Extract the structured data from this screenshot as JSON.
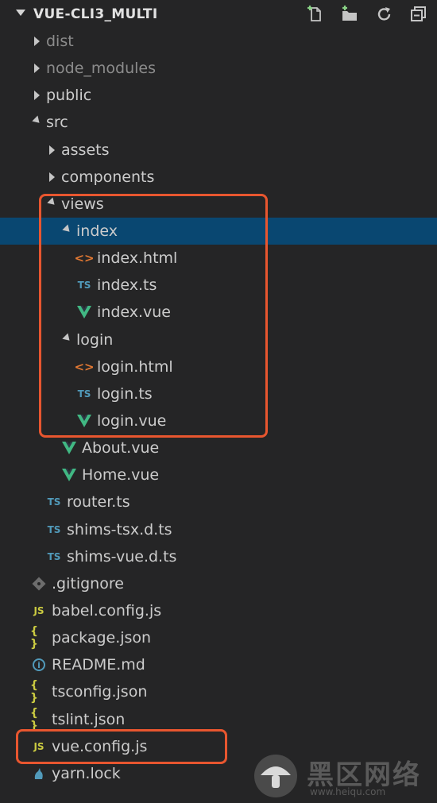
{
  "explorer": {
    "title": "VUE-CLI3_MULTI",
    "actions": [
      {
        "name": "new-file",
        "icon": "new-file-icon"
      },
      {
        "name": "new-folder",
        "icon": "new-folder-icon"
      },
      {
        "name": "refresh",
        "icon": "refresh-icon"
      },
      {
        "name": "collapse-all",
        "icon": "collapse-all-icon"
      }
    ]
  },
  "tree": [
    {
      "label": "dist",
      "type": "folder",
      "expanded": false,
      "depth": 0,
      "dim": true
    },
    {
      "label": "node_modules",
      "type": "folder",
      "expanded": false,
      "depth": 0,
      "dim": true
    },
    {
      "label": "public",
      "type": "folder",
      "expanded": false,
      "depth": 0
    },
    {
      "label": "src",
      "type": "folder",
      "expanded": true,
      "depth": 0
    },
    {
      "label": "assets",
      "type": "folder",
      "expanded": false,
      "depth": 1
    },
    {
      "label": "components",
      "type": "folder",
      "expanded": false,
      "depth": 1
    },
    {
      "label": "views",
      "type": "folder",
      "expanded": true,
      "depth": 1
    },
    {
      "label": "index",
      "type": "folder",
      "expanded": true,
      "depth": 2,
      "selected": true
    },
    {
      "label": "index.html",
      "type": "html",
      "depth": 3
    },
    {
      "label": "index.ts",
      "type": "ts",
      "depth": 3
    },
    {
      "label": "index.vue",
      "type": "vue",
      "depth": 3
    },
    {
      "label": "login",
      "type": "folder",
      "expanded": true,
      "depth": 2
    },
    {
      "label": "login.html",
      "type": "html",
      "depth": 3
    },
    {
      "label": "login.ts",
      "type": "ts",
      "depth": 3
    },
    {
      "label": "login.vue",
      "type": "vue",
      "depth": 3
    },
    {
      "label": "About.vue",
      "type": "vue",
      "depth": 2
    },
    {
      "label": "Home.vue",
      "type": "vue",
      "depth": 2
    },
    {
      "label": "router.ts",
      "type": "ts",
      "depth": 1
    },
    {
      "label": "shims-tsx.d.ts",
      "type": "ts",
      "depth": 1
    },
    {
      "label": "shims-vue.d.ts",
      "type": "ts",
      "depth": 1
    },
    {
      "label": ".gitignore",
      "type": "git",
      "depth": 0
    },
    {
      "label": "babel.config.js",
      "type": "js",
      "depth": 0
    },
    {
      "label": "package.json",
      "type": "json",
      "depth": 0
    },
    {
      "label": "README.md",
      "type": "info",
      "depth": 0
    },
    {
      "label": "tsconfig.json",
      "type": "json",
      "depth": 0
    },
    {
      "label": "tslint.json",
      "type": "json",
      "depth": 0
    },
    {
      "label": "vue.config.js",
      "type": "js",
      "depth": 0
    },
    {
      "label": "yarn.lock",
      "type": "yarn",
      "depth": 0
    }
  ],
  "icon_text": {
    "ts": "TS",
    "js": "JS",
    "json": "{ }",
    "html": "<>",
    "info": "i"
  },
  "colors": {
    "selected_row": "#094771",
    "highlight_box": "#e8562f",
    "vue_green": "#41b883",
    "ts_blue": "#519aba",
    "js_yellow": "#cbcb41",
    "html_orange": "#e37933"
  },
  "watermark": {
    "text": "黑区网络",
    "url": "www.heiqu.com"
  }
}
